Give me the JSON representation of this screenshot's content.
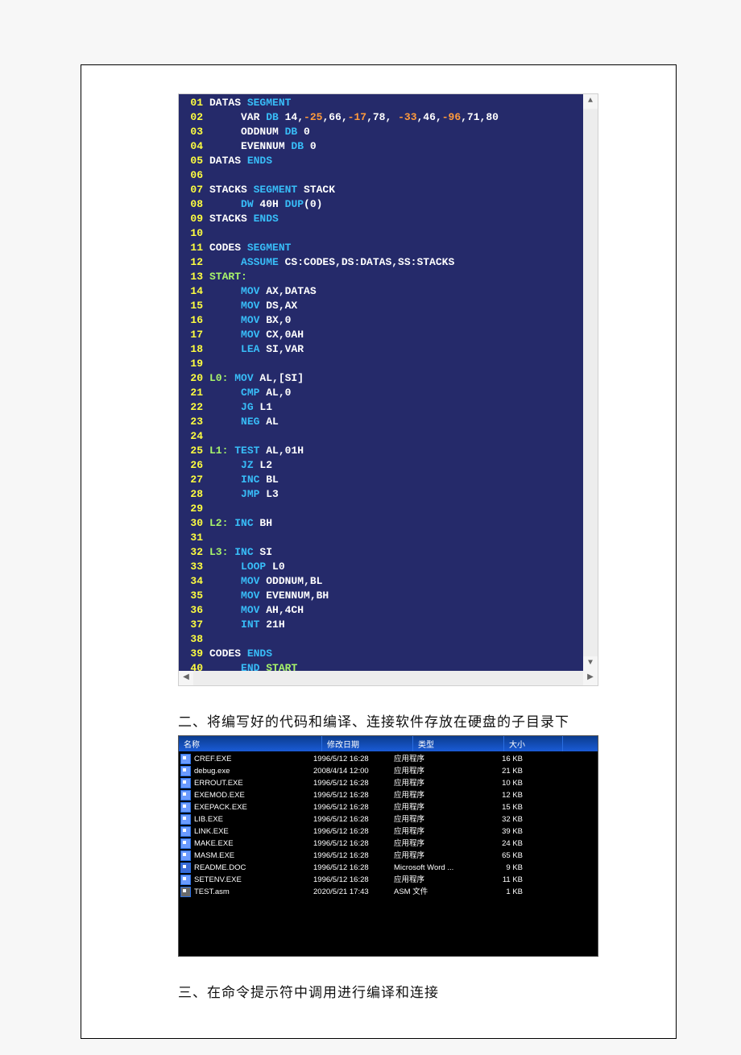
{
  "code": {
    "lines": [
      {
        "n": "01",
        "html": "DATAS <kw>SEGMENT</kw>"
      },
      {
        "n": "02",
        "html": "     VAR <kw>DB</kw> 14,<num>-25</num>,66,<num>-17</num>,78, <num>-33</num>,46,<num>-96</num>,71,80"
      },
      {
        "n": "03",
        "html": "     ODDNUM <kw>DB</kw> 0"
      },
      {
        "n": "04",
        "html": "     EVENNUM <kw>DB</kw> 0"
      },
      {
        "n": "05",
        "html": "DATAS <kw>ENDS</kw>"
      },
      {
        "n": "06",
        "html": ""
      },
      {
        "n": "07",
        "html": "STACKS <kw>SEGMENT</kw> STACK"
      },
      {
        "n": "08",
        "html": "     <kw>DW</kw> 40H <kw>DUP</kw>(0)"
      },
      {
        "n": "09",
        "html": "STACKS <kw>ENDS</kw>"
      },
      {
        "n": "10",
        "html": ""
      },
      {
        "n": "11",
        "html": "CODES <kw>SEGMENT</kw>"
      },
      {
        "n": "12",
        "html": "     <kw>ASSUME</kw> CS:CODES,DS:DATAS,SS:STACKS"
      },
      {
        "n": "13",
        "html": "<lbl>START:</lbl>"
      },
      {
        "n": "14",
        "html": "     <kw>MOV</kw> AX,DATAS"
      },
      {
        "n": "15",
        "html": "     <kw>MOV</kw> DS,AX"
      },
      {
        "n": "16",
        "html": "     <kw>MOV</kw> BX,0"
      },
      {
        "n": "17",
        "html": "     <kw>MOV</kw> CX,0AH"
      },
      {
        "n": "18",
        "html": "     <kw>LEA</kw> SI,VAR"
      },
      {
        "n": "19",
        "html": ""
      },
      {
        "n": "20",
        "html": "<lbl>L0:</lbl> <kw>MOV</kw> AL,[SI]"
      },
      {
        "n": "21",
        "html": "     <kw>CMP</kw> AL,0"
      },
      {
        "n": "22",
        "html": "     <kw>JG</kw> L1"
      },
      {
        "n": "23",
        "html": "     <kw>NEG</kw> AL"
      },
      {
        "n": "24",
        "html": ""
      },
      {
        "n": "25",
        "html": "<lbl>L1:</lbl> <kw>TEST</kw> AL,01H"
      },
      {
        "n": "26",
        "html": "     <kw>JZ</kw> L2"
      },
      {
        "n": "27",
        "html": "     <kw>INC</kw> BL"
      },
      {
        "n": "28",
        "html": "     <kw>JMP</kw> L3"
      },
      {
        "n": "29",
        "html": ""
      },
      {
        "n": "30",
        "html": "<lbl>L2:</lbl> <kw>INC</kw> BH"
      },
      {
        "n": "31",
        "html": ""
      },
      {
        "n": "32",
        "html": "<lbl>L3:</lbl> <kw>INC</kw> SI"
      },
      {
        "n": "33",
        "html": "     <kw>LOOP</kw> L0"
      },
      {
        "n": "34",
        "html": "     <kw>MOV</kw> ODDNUM,BL"
      },
      {
        "n": "35",
        "html": "     <kw>MOV</kw> EVENNUM,BH"
      },
      {
        "n": "36",
        "html": "     <kw>MOV</kw> AH,4CH"
      },
      {
        "n": "37",
        "html": "     <kw>INT</kw> 21H"
      },
      {
        "n": "38",
        "html": ""
      },
      {
        "n": "39",
        "html": "CODES <kw>ENDS</kw>"
      },
      {
        "n": "40",
        "html": "     <kw>END</kw> <lbl>START</lbl>"
      }
    ]
  },
  "section2_title": "二、将编写好的代码和编译、连接软件存放在硬盘的子目录下",
  "section3_title": "三、在命令提示符中调用进行编译和连接",
  "filelist": {
    "headers": {
      "name": "名称",
      "date": "修改日期",
      "type": "类型",
      "size": "大小"
    },
    "rows": [
      {
        "icon": "exe",
        "name": "CREF.EXE",
        "date": "1996/5/12 16:28",
        "type": "应用程序",
        "size": "16 KB"
      },
      {
        "icon": "exe",
        "name": "debug.exe",
        "date": "2008/4/14 12:00",
        "type": "应用程序",
        "size": "21 KB"
      },
      {
        "icon": "exe",
        "name": "ERROUT.EXE",
        "date": "1996/5/12 16:28",
        "type": "应用程序",
        "size": "10 KB"
      },
      {
        "icon": "exe",
        "name": "EXEMOD.EXE",
        "date": "1996/5/12 16:28",
        "type": "应用程序",
        "size": "12 KB"
      },
      {
        "icon": "exe",
        "name": "EXEPACK.EXE",
        "date": "1996/5/12 16:28",
        "type": "应用程序",
        "size": "15 KB"
      },
      {
        "icon": "exe",
        "name": "LIB.EXE",
        "date": "1996/5/12 16:28",
        "type": "应用程序",
        "size": "32 KB"
      },
      {
        "icon": "exe",
        "name": "LINK.EXE",
        "date": "1996/5/12 16:28",
        "type": "应用程序",
        "size": "39 KB"
      },
      {
        "icon": "exe",
        "name": "MAKE.EXE",
        "date": "1996/5/12 16:28",
        "type": "应用程序",
        "size": "24 KB"
      },
      {
        "icon": "exe",
        "name": "MASM.EXE",
        "date": "1996/5/12 16:28",
        "type": "应用程序",
        "size": "65 KB"
      },
      {
        "icon": "doc",
        "name": "README.DOC",
        "date": "1996/5/12 16:28",
        "type": "Microsoft Word ...",
        "size": "9 KB"
      },
      {
        "icon": "exe",
        "name": "SETENV.EXE",
        "date": "1996/5/12 16:28",
        "type": "应用程序",
        "size": "11 KB"
      },
      {
        "icon": "asm",
        "name": "TEST.asm",
        "date": "2020/5/21 17:43",
        "type": "ASM 文件",
        "size": "1 KB"
      }
    ]
  }
}
